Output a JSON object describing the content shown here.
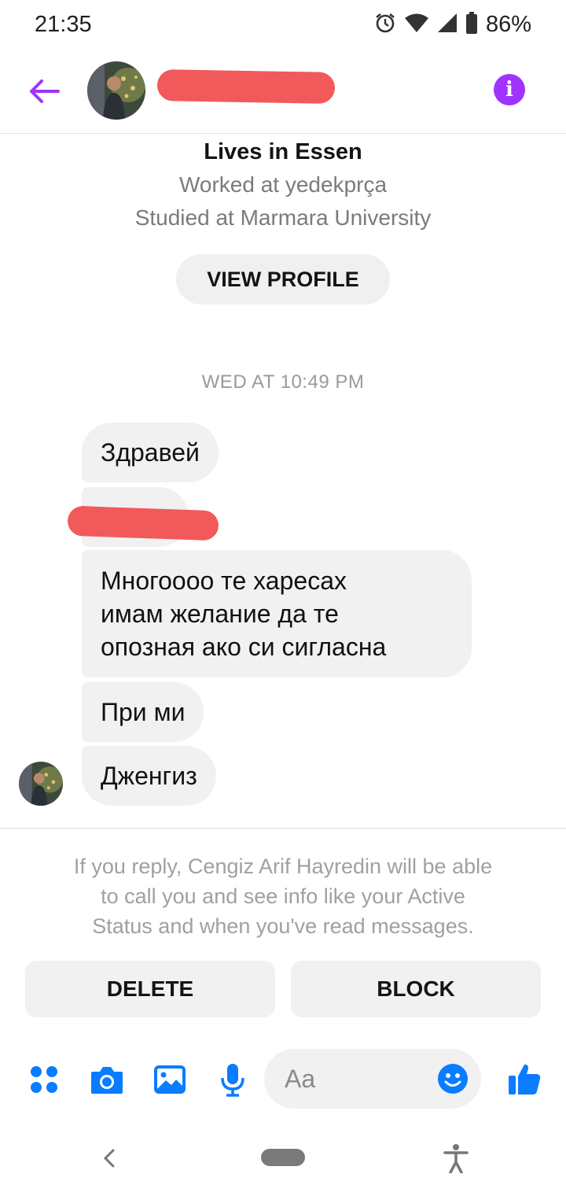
{
  "status_bar": {
    "time": "21:35",
    "battery": "86%"
  },
  "header": {
    "back_icon": "arrow-left-icon",
    "info_icon": "info-icon",
    "accent": "#a033ff"
  },
  "profile": {
    "lives": "Lives in Essen",
    "worked": "Worked at yedekprça",
    "studied": "Studied at Marmara University",
    "view_profile_label": "VIEW PROFILE"
  },
  "conversation": {
    "timestamp": "WED AT 10:49 PM",
    "messages": [
      {
        "text": "Здравей"
      },
      {
        "text": ""
      },
      {
        "lines": [
          "Многоооо те харесах",
          "имам желание да те",
          "опозная ако си сигласна"
        ]
      },
      {
        "text": "При ми"
      },
      {
        "text": "Дженгиз"
      }
    ]
  },
  "request": {
    "note_lines": [
      "If you reply, Cengiz Arif Hayredin will be able",
      "to call you and see info like your Active",
      "Status and when you've read messages."
    ],
    "delete_label": "DELETE",
    "block_label": "BLOCK"
  },
  "composer": {
    "placeholder": "Aa",
    "icons": [
      "apps-icon",
      "camera-icon",
      "image-icon",
      "microphone-icon",
      "emoji-icon",
      "thumbs-up-icon"
    ],
    "accent": "#0a7cff"
  },
  "redaction_color": "#f2595a"
}
